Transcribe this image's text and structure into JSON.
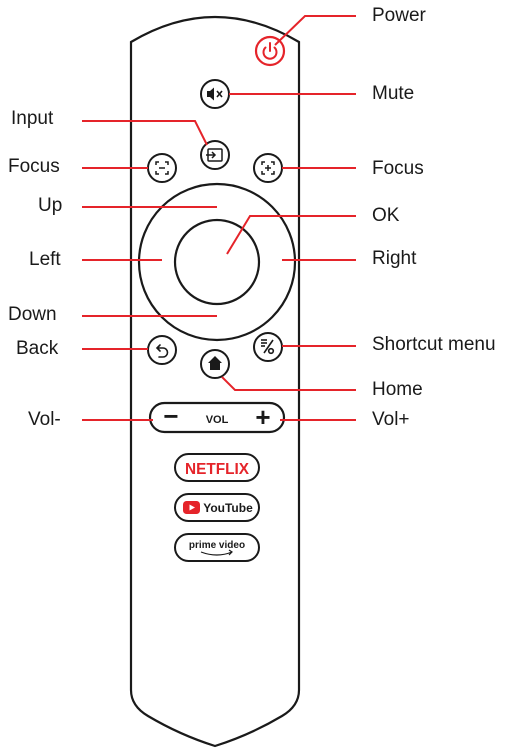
{
  "accent_color": "#e5242a",
  "outline_color": "#1a1a1a",
  "labels": {
    "power": "Power",
    "mute": "Mute",
    "input": "Input",
    "focus_left": "Focus",
    "focus_right": "Focus",
    "up": "Up",
    "ok": "OK",
    "left": "Left",
    "right": "Right",
    "down": "Down",
    "back": "Back",
    "shortcut_menu": "Shortcut menu",
    "home": "Home",
    "vol_minus": "Vol-",
    "vol_plus": "Vol+"
  },
  "remote": {
    "vol_text": "VOL",
    "vol_minus_symbol": "−",
    "vol_plus_symbol": "+",
    "netflix": "NETFLIX",
    "youtube": "YouTube",
    "prime_video": "prime video"
  },
  "icons": {
    "power": "power-icon",
    "mute": "mute-icon",
    "input": "input-icon",
    "focus_left": "focus-minus-icon",
    "focus_right": "focus-plus-icon",
    "back": "back-icon",
    "shortcut": "shortcut-icon",
    "home": "home-icon"
  }
}
